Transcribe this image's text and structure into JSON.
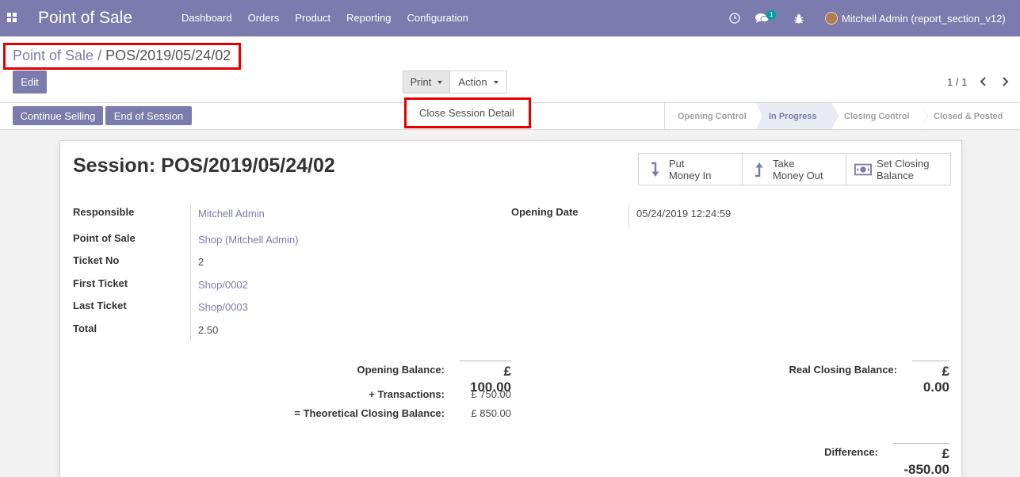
{
  "navbar": {
    "app_name": "Point of Sale",
    "menu": [
      "Dashboard",
      "Orders",
      "Product",
      "Reporting",
      "Configuration"
    ],
    "chat_count": "1",
    "user": "Mitchell Admin (report_section_v12)",
    "color": "#7c7bad"
  },
  "breadcrumb": {
    "parent": "Point of Sale",
    "separator": "/",
    "current": "POS/2019/05/24/02"
  },
  "control": {
    "edit_label": "Edit",
    "print_label": "Print",
    "action_label": "Action",
    "pager": "1 / 1",
    "dropdown_item": "Close Session Detail"
  },
  "statusbar": {
    "continue_label": "Continue Selling",
    "end_label": "End of Session",
    "stages": [
      "Opening Control",
      "In Progress",
      "Closing Control",
      "Closed & Posted"
    ],
    "active_stage": "In Progress"
  },
  "sheet": {
    "title": "Session: POS/2019/05/24/02",
    "smart_buttons": [
      {
        "line1": "Put",
        "line2": "Money In",
        "icon": "level-down-icon"
      },
      {
        "line1": "Take",
        "line2": "Money Out",
        "icon": "level-up-icon"
      },
      {
        "line1": "Set Closing",
        "line2": "Balance",
        "icon": "money-icon"
      }
    ],
    "fields": {
      "responsible_label": "Responsible",
      "responsible": "Mitchell Admin",
      "pos_label": "Point of Sale",
      "pos": "Shop (Mitchell Admin)",
      "ticket_no_label": "Ticket No",
      "ticket_no": "2",
      "first_ticket_label": "First Ticket",
      "first_ticket": "Shop/0002",
      "last_ticket_label": "Last Ticket",
      "last_ticket": "Shop/0003",
      "total_label": "Total",
      "total": "2.50",
      "opening_date_label": "Opening Date",
      "opening_date": "05/24/2019 12:24:59"
    },
    "balances": {
      "opening_label": "Opening Balance:",
      "opening": "£ 100.00",
      "transactions_label": "+ Transactions:",
      "transactions": "£ 750.00",
      "theoretical_label": "= Theoretical Closing Balance:",
      "theoretical": "£ 850.00",
      "real_label": "Real Closing Balance:",
      "real": "£ 0.00",
      "difference_label": "Difference:",
      "difference": "£ -850.00"
    }
  }
}
